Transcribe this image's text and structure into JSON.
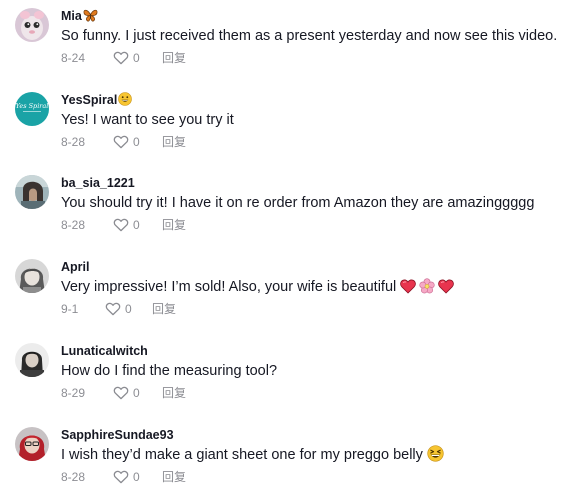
{
  "comments": [
    {
      "username": "Mia",
      "username_emoji": "butterfly",
      "text": "So funny. I just received them as a present yesterday and now see this video.",
      "date": "8-24",
      "likes": "0",
      "reply_label": "回复"
    },
    {
      "username": "YesSpiral",
      "username_emoji": "grinning-face",
      "text": "Yes! I want to see you try it",
      "date": "8-28",
      "likes": "0",
      "reply_label": "回复"
    },
    {
      "username": "ba_sia_1221",
      "text": "You should try it! I have it on re order from Amazon they are amazinggggg",
      "date": "8-28",
      "likes": "0",
      "reply_label": "回复"
    },
    {
      "username": "April",
      "text": "Very impressive! I’m sold! Also, your wife is beautiful",
      "text_emojis": [
        "red-heart",
        "cherry-blossom",
        "red-heart"
      ],
      "date": "9-1",
      "likes": "0",
      "reply_label": "回复"
    },
    {
      "username": "Lunaticalwitch",
      "text": "How do I find the measuring tool?",
      "date": "8-29",
      "likes": "0",
      "reply_label": "回复"
    },
    {
      "username": "SapphireSundae93",
      "text": "I wish they’d make a giant sheet one for my preggo belly",
      "text_emojis": [
        "grinning-squinting-face"
      ],
      "date": "8-28",
      "likes": "0",
      "reply_label": "回复"
    }
  ],
  "avatar_logo_text": "Yes Spiral",
  "colors": {
    "text": "#161823",
    "muted": "#8a8b91",
    "avatar_teal": "#1aa3a6"
  }
}
